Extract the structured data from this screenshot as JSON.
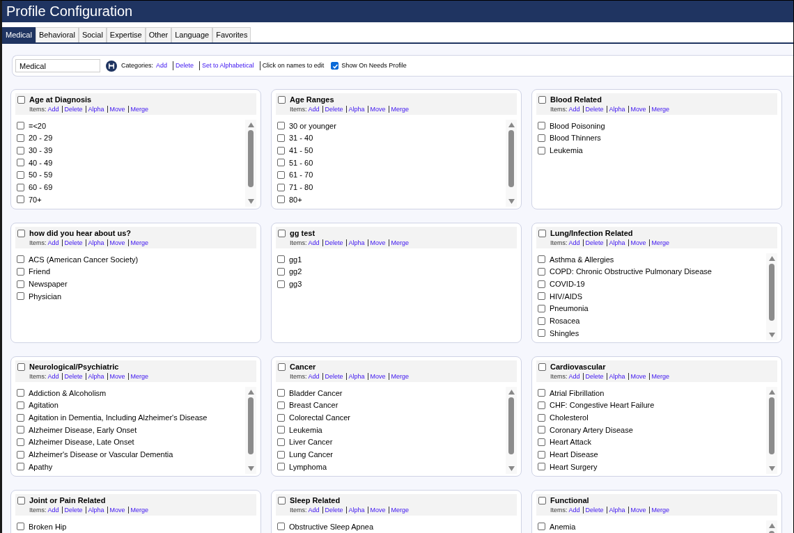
{
  "window": {
    "title": "Profile Configuration"
  },
  "tabs": [
    {
      "label": "Medical",
      "selected": true
    },
    {
      "label": "Behavioral",
      "selected": false
    },
    {
      "label": "Social",
      "selected": false
    },
    {
      "label": "Expertise",
      "selected": false
    },
    {
      "label": "Other",
      "selected": false
    },
    {
      "label": "Language",
      "selected": false
    },
    {
      "label": "Favorites",
      "selected": false
    }
  ],
  "toolbar": {
    "name_value": "Medical",
    "categories_label": "Categories:",
    "links": [
      "Add",
      "Delete",
      "Set to Alphabetical"
    ],
    "hint": "Click on names to edit",
    "show_on_needs_profile": {
      "label": "Show On Needs Profile",
      "checked": true
    }
  },
  "categories": [
    {
      "title": "Age at Diagnosis",
      "checked": false,
      "links_label": "Items:",
      "links": [
        "Add",
        "Delete",
        "Alpha",
        "Move",
        "Merge"
      ],
      "scrollable": true,
      "items": [
        {
          "label": "=<20",
          "checked": false
        },
        {
          "label": "20 - 29",
          "checked": false
        },
        {
          "label": "30 - 39",
          "checked": false
        },
        {
          "label": "40 - 49",
          "checked": false
        },
        {
          "label": "50 - 59",
          "checked": false
        },
        {
          "label": "60 - 69",
          "checked": false
        },
        {
          "label": "70+",
          "checked": false
        }
      ]
    },
    {
      "title": "Age Ranges",
      "checked": false,
      "links_label": "Items:",
      "links": [
        "Add",
        "Delete",
        "Alpha",
        "Move",
        "Merge"
      ],
      "scrollable": true,
      "items": [
        {
          "label": "30 or younger",
          "checked": false
        },
        {
          "label": "31 - 40",
          "checked": false
        },
        {
          "label": "41 - 50",
          "checked": false
        },
        {
          "label": "51 - 60",
          "checked": false
        },
        {
          "label": "61 - 70",
          "checked": false
        },
        {
          "label": "71 - 80",
          "checked": false
        },
        {
          "label": "80+",
          "checked": false
        }
      ]
    },
    {
      "title": "Blood Related",
      "checked": false,
      "links_label": "Items:",
      "links": [
        "Add",
        "Delete",
        "Alpha",
        "Move",
        "Merge"
      ],
      "scrollable": false,
      "items": [
        {
          "label": "Blood Poisoning",
          "checked": false
        },
        {
          "label": "Blood Thinners",
          "checked": false
        },
        {
          "label": "Leukemia",
          "checked": false
        }
      ]
    },
    {
      "title": "how did you hear about us?",
      "checked": false,
      "links_label": "Items:",
      "links": [
        "Add",
        "Delete",
        "Alpha",
        "Move",
        "Merge"
      ],
      "scrollable": false,
      "items": [
        {
          "label": "ACS (American Cancer Society)",
          "checked": false
        },
        {
          "label": "Friend",
          "checked": false
        },
        {
          "label": "Newspaper",
          "checked": false
        },
        {
          "label": "Physician",
          "checked": false
        }
      ]
    },
    {
      "title": "gg test",
      "checked": false,
      "links_label": "Items:",
      "links": [
        "Add",
        "Delete",
        "Alpha",
        "Move",
        "Merge"
      ],
      "scrollable": false,
      "items": [
        {
          "label": "gg1",
          "checked": false
        },
        {
          "label": "gg2",
          "checked": false
        },
        {
          "label": "gg3",
          "checked": false
        }
      ]
    },
    {
      "title": "Lung/Infection Related",
      "checked": false,
      "links_label": "Items:",
      "links": [
        "Add",
        "Delete",
        "Alpha",
        "Move",
        "Merge"
      ],
      "scrollable": true,
      "items": [
        {
          "label": "Asthma & Allergies",
          "checked": false
        },
        {
          "label": "COPD: Chronic Obstructive Pulmonary Disease",
          "checked": false
        },
        {
          "label": "COVID-19",
          "checked": false
        },
        {
          "label": "HIV/AIDS",
          "checked": false
        },
        {
          "label": "Pneumonia",
          "checked": false
        },
        {
          "label": "Rosacea",
          "checked": false
        },
        {
          "label": "Shingles",
          "checked": false
        }
      ]
    },
    {
      "title": "Neurological/Psychiatric",
      "checked": false,
      "links_label": "Items:",
      "links": [
        "Add",
        "Delete",
        "Alpha",
        "Move",
        "Merge"
      ],
      "scrollable": true,
      "items": [
        {
          "label": "Addiction & Alcoholism",
          "checked": false
        },
        {
          "label": "Agitation",
          "checked": false
        },
        {
          "label": "Agitation in Dementia, Including Alzheimer's Disease",
          "checked": false
        },
        {
          "label": "Alzheimer Disease, Early Onset",
          "checked": false
        },
        {
          "label": "Alzheimer Disease, Late Onset",
          "checked": false
        },
        {
          "label": "Alzheimer's Disease or Vascular Dementia",
          "checked": false
        },
        {
          "label": "Apathy",
          "checked": false
        }
      ]
    },
    {
      "title": "Cancer",
      "checked": false,
      "links_label": "Items:",
      "links": [
        "Add",
        "Delete",
        "Alpha",
        "Move",
        "Merge"
      ],
      "scrollable": true,
      "items": [
        {
          "label": "Bladder Cancer",
          "checked": false
        },
        {
          "label": "Breast Cancer",
          "checked": false
        },
        {
          "label": "Colorectal Cancer",
          "checked": false
        },
        {
          "label": "Leukemia",
          "checked": false
        },
        {
          "label": "Liver Cancer",
          "checked": false
        },
        {
          "label": "Lung Cancer",
          "checked": false
        },
        {
          "label": "Lymphoma",
          "checked": false
        }
      ]
    },
    {
      "title": "Cardiovascular",
      "checked": false,
      "links_label": "Items:",
      "links": [
        "Add",
        "Delete",
        "Alpha",
        "Move",
        "Merge"
      ],
      "scrollable": true,
      "items": [
        {
          "label": "Atrial Fibrillation",
          "checked": false
        },
        {
          "label": "CHF: Congestive Heart Failure",
          "checked": false
        },
        {
          "label": "Cholesterol",
          "checked": false
        },
        {
          "label": "Coronary Artery Disease",
          "checked": false
        },
        {
          "label": "Heart Attack",
          "checked": false
        },
        {
          "label": "Heart Disease",
          "checked": false
        },
        {
          "label": "Heart Surgery",
          "checked": false
        }
      ]
    },
    {
      "title": "Joint or Pain Related",
      "checked": false,
      "links_label": "Items:",
      "links": [
        "Add",
        "Delete",
        "Alpha",
        "Move",
        "Merge"
      ],
      "scrollable": false,
      "items": [
        {
          "label": "Broken Hip",
          "checked": false
        }
      ]
    },
    {
      "title": "Sleep Related",
      "checked": false,
      "links_label": "Items:",
      "links": [
        "Add",
        "Delete",
        "Alpha",
        "Move",
        "Merge"
      ],
      "scrollable": false,
      "items": [
        {
          "label": "Obstructive Sleep Apnea",
          "checked": false
        }
      ]
    },
    {
      "title": "Functional",
      "checked": false,
      "links_label": "Items:",
      "links": [
        "Add",
        "Delete",
        "Alpha",
        "Move",
        "Merge"
      ],
      "scrollable": true,
      "items": [
        {
          "label": "Anemia",
          "checked": false
        }
      ]
    }
  ]
}
